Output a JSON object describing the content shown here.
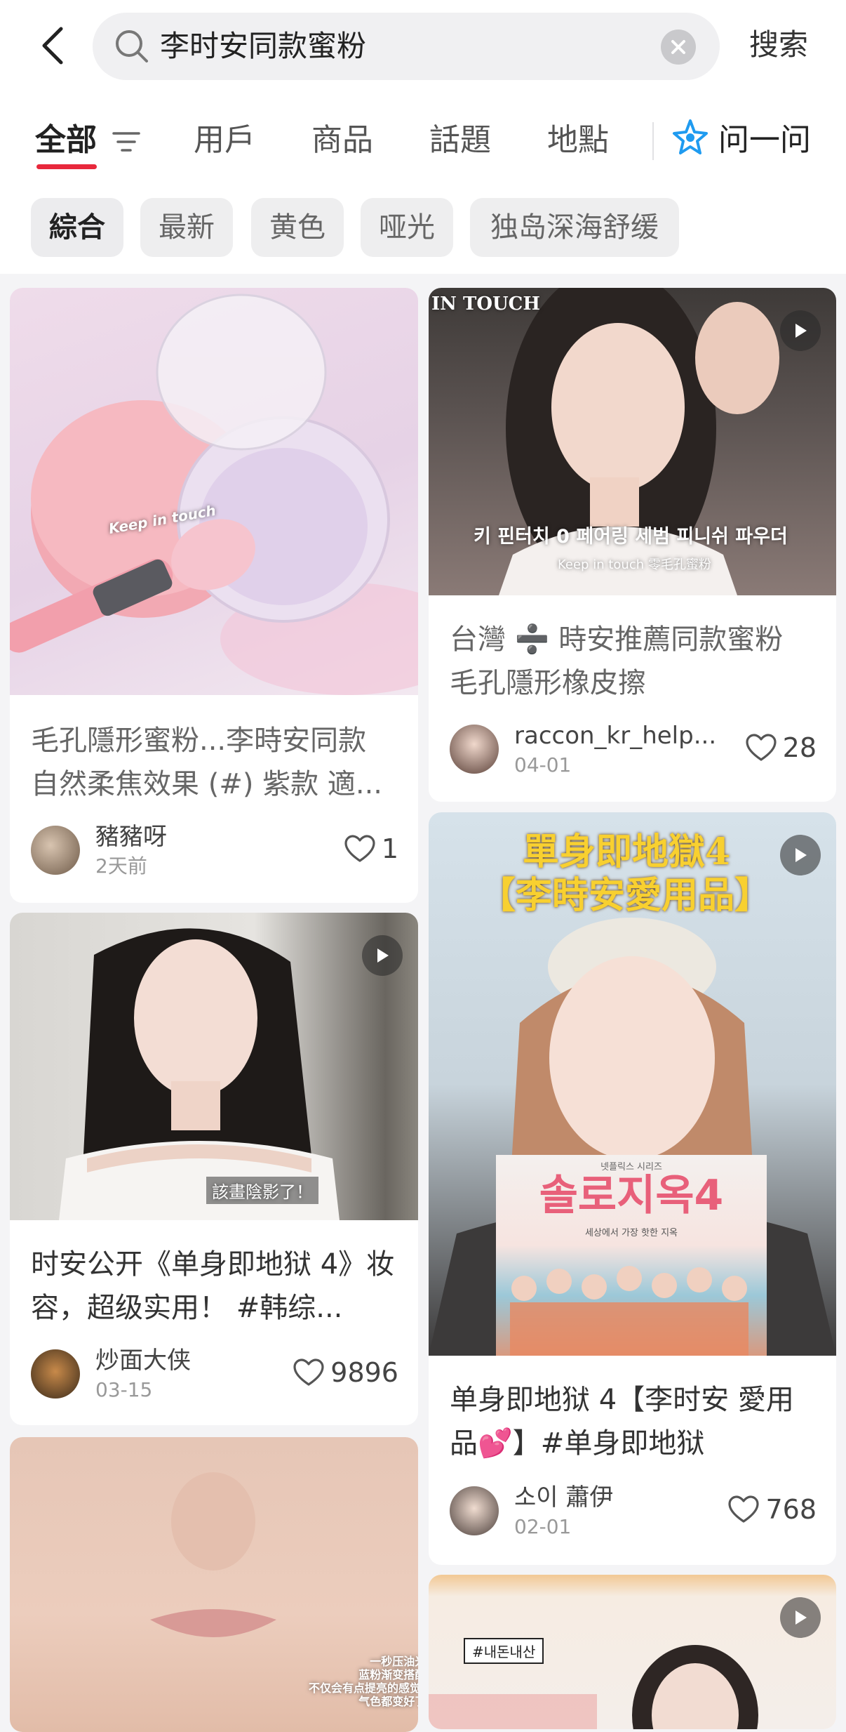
{
  "search": {
    "query": "李时安同款蜜粉",
    "button_label": "搜索"
  },
  "tabs": [
    {
      "label": "全部"
    },
    {
      "label": "用戶"
    },
    {
      "label": "商品"
    },
    {
      "label": "話題"
    },
    {
      "label": "地點"
    }
  ],
  "ask": {
    "label": "问一问"
  },
  "chips": [
    {
      "label": "綜合"
    },
    {
      "label": "最新"
    },
    {
      "label": "黄色"
    },
    {
      "label": "哑光"
    },
    {
      "label": "独岛深海舒缓"
    }
  ],
  "cards": [
    {
      "title": "毛孔隱形蜜粉...李時安同款 自然柔焦效果 (#) 紫款 適...",
      "author": "豬豬呀",
      "date": "2天前",
      "likes": "1",
      "cover_text": "Keep in touch"
    },
    {
      "title": "台灣 ➗ 時安推薦同款蜜粉 毛孔隱形橡皮擦",
      "author": "raccon_kr_help...",
      "date": "04-01",
      "likes": "28",
      "cover_brand": "IN TOUCH",
      "cover_caption_ko": "키 핀터치 0 페어링 세범 피니쉬 파우더",
      "cover_caption_zh": "Keep in touch 零毛孔蜜粉"
    },
    {
      "title": "时安公开《单身即地狱 4》妆容，超级实用！ #韩综...",
      "author": "炒面大侠",
      "date": "03-15",
      "likes": "9896",
      "cover_caption": "該畫陰影了！"
    },
    {
      "title": "单身即地狱 4【李时安 愛用品💕】#单身即地狱",
      "author": "소이 蕭伊",
      "date": "02-01",
      "likes": "768",
      "cover_line1": "單身即地獄4",
      "cover_line2": "【李時安愛用品】",
      "poster_title": "솔로지옥4",
      "poster_top": "넷플릭스 시리즈",
      "poster_sub": "세상에서 가장 핫한 지옥"
    },
    {
      "cover_caption": "一秒压油光\n蓝粉渐变搭配\n不仅会有点提亮的感觉!\n气色都变好了"
    },
    {
      "cover_tag": "#내돈내산"
    }
  ],
  "colors": {
    "accent": "#e8283c",
    "ask_icon": "#1f9bf0"
  }
}
